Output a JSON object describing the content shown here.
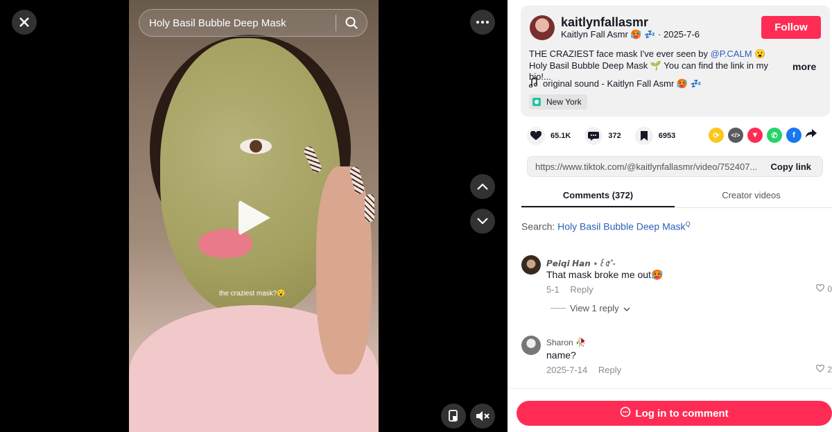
{
  "video": {
    "search_query": "Holy Basil Bubble Deep Mask",
    "caption": "the craziest mask?😮"
  },
  "creator": {
    "username": "kaitlynfallasmr",
    "display_name": "Kaitlyn Fall Asmr 🥵 💤",
    "date": "2025-7-6",
    "follow_label": "Follow",
    "description_pre": "THE CRAZIEST face mask I've ever seen by ",
    "description_mention": "@P.CALM",
    "description_post": " 😮 Holy Basil Bubble Deep Mask 🌱 You can find the link in my bio!...",
    "more_label": "more",
    "sound": "original sound - Kaitlyn Fall Asmr 🥵 💤",
    "location": "New York"
  },
  "actions": {
    "likes": "65.1K",
    "comments": "372",
    "saves": "6953"
  },
  "share": {
    "link": "https://www.tiktok.com/@kaitlynfallasmr/video/752407...",
    "copy_label": "Copy link"
  },
  "tabs": {
    "comments": "Comments (372)",
    "creator_videos": "Creator videos"
  },
  "search_line": {
    "prefix": "Search: ",
    "keyword": "Holy Basil Bubble Deep Mask"
  },
  "comments": [
    {
      "name": "𝙋𝙚𝙞𝙦𝙞 𝙃𝙖𝙣 ⋆꒰৫˚-",
      "text": "That mask broke me out🥵",
      "date": "5-1",
      "reply_label": "Reply",
      "likes": "0",
      "view_replies": "View 1 reply"
    },
    {
      "name": "Sharon 🥀",
      "text": "name?",
      "date": "2025-7-14",
      "reply_label": "Reply",
      "likes": "2"
    }
  ],
  "bottom": {
    "login_label": "Log in to comment"
  },
  "colors": {
    "brand_red": "#fe2c55",
    "link_blue": "#2b5db9"
  }
}
